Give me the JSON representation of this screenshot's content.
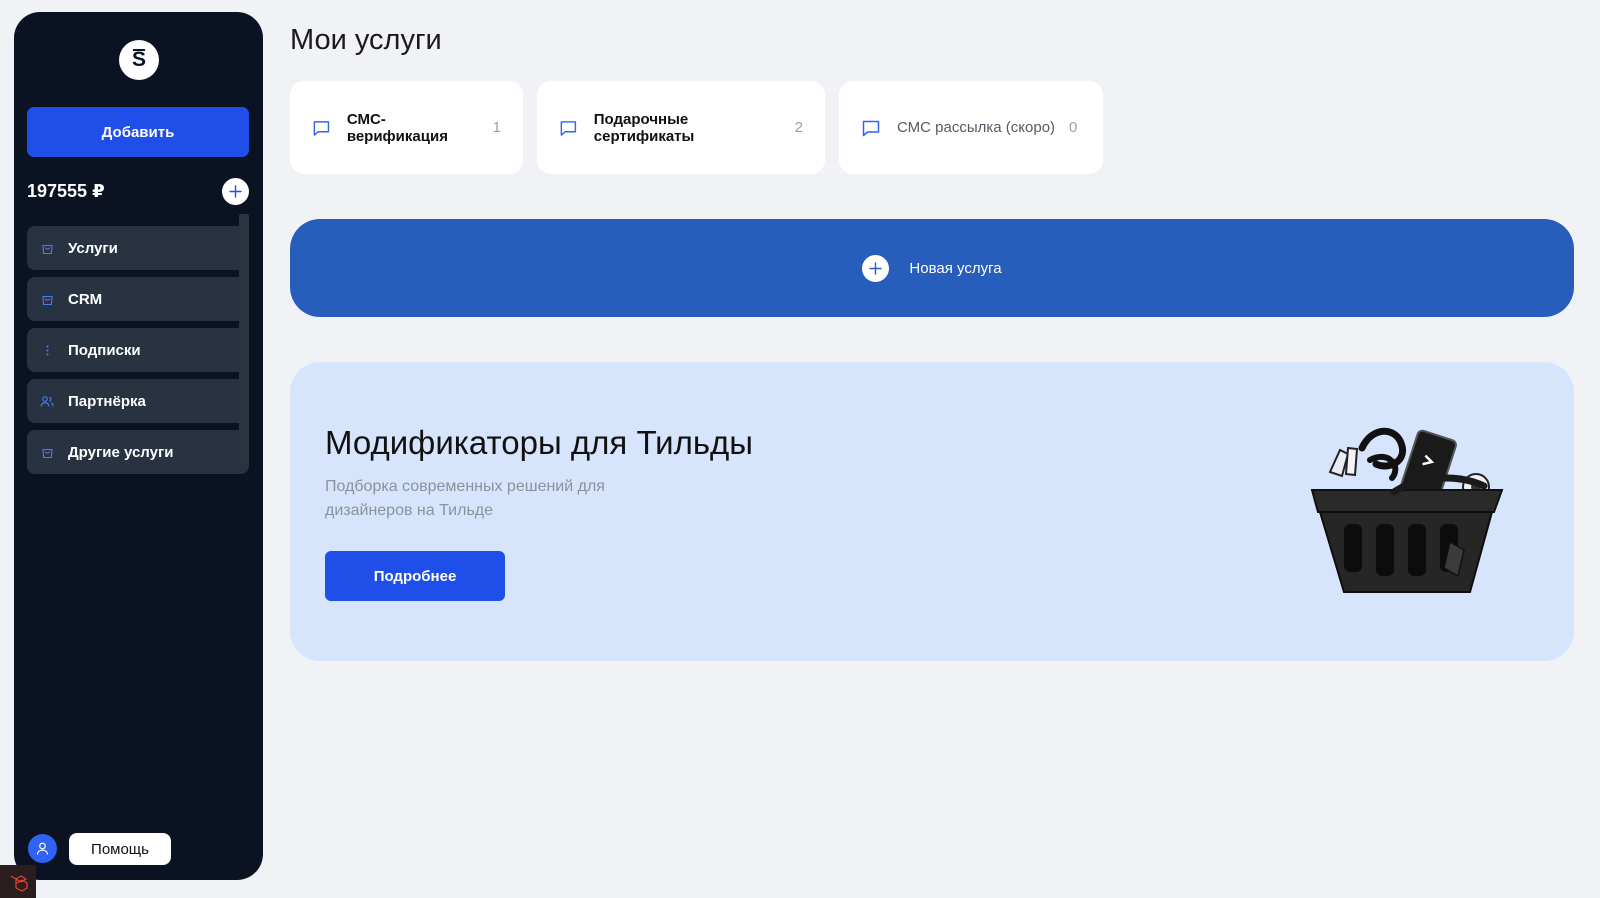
{
  "sidebar": {
    "logo_letter": "S",
    "add_button_label": "Добавить",
    "balance": "197555 ₽",
    "items": [
      {
        "label": "Услуги",
        "icon": "bag-icon"
      },
      {
        "label": "CRM",
        "icon": "bag-icon"
      },
      {
        "label": "Подписки",
        "icon": "more-vertical-icon"
      },
      {
        "label": "Партнёрка",
        "icon": "users-icon"
      },
      {
        "label": "Другие услуги",
        "icon": "bag-icon"
      }
    ],
    "help_label": "Помощь"
  },
  "main": {
    "title": "Мои услуги",
    "service_cards": [
      {
        "label": "СМС-верификация",
        "count": "1"
      },
      {
        "label": "Подарочные сертификаты",
        "count": "2"
      },
      {
        "label": "СМС рассылка (скоро)",
        "count": "0"
      }
    ],
    "new_service_label": "Новая услуга",
    "promo": {
      "title": "Модификаторы для Тильды",
      "subtitle": "Подборка современных решений для дизайнеров на Тильде",
      "button_label": "Подробнее"
    }
  },
  "colors": {
    "sidebar_bg": "#0b1322",
    "primary": "#1f4ee8",
    "banner": "#275dbb",
    "promo_bg": "#d6e5fb",
    "page_bg": "#f0f2f6"
  }
}
